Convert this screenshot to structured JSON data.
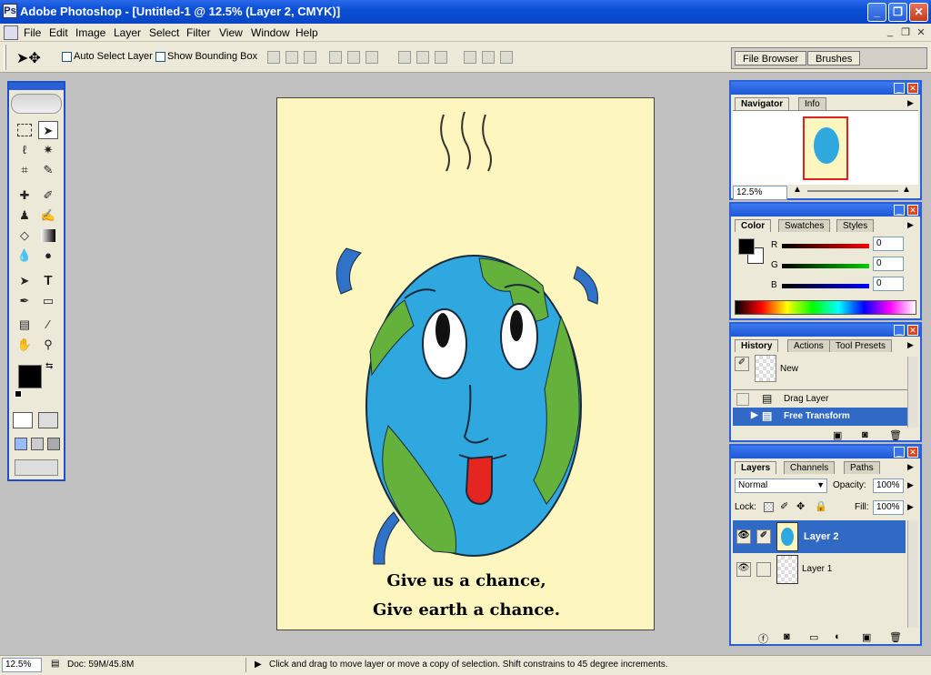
{
  "window": {
    "title": "Adobe Photoshop - [Untitled-1 @ 12.5% (Layer 2, CMYK)]",
    "app_icon": "photoshop-icon",
    "minimize_glyph": "_",
    "maximize_glyph": "❐",
    "close_glyph": "✕"
  },
  "menu": {
    "items": [
      "File",
      "Edit",
      "Image",
      "Layer",
      "Select",
      "Filter",
      "View",
      "Window",
      "Help"
    ],
    "mdi_minimize": "_",
    "mdi_restore": "❐",
    "mdi_close": "✕"
  },
  "options": {
    "auto_select_label": "Auto Select Layer",
    "bounding_box_label": "Show Bounding Box",
    "palette_well_tabs": [
      "File Browser",
      "Brushes"
    ]
  },
  "canvas": {
    "caption_line1": "Give us a chance,",
    "caption_line2": "Give earth a chance.",
    "bg_color": "#fdf6be",
    "ocean_color": "#2fa8e0",
    "land_color": "#64b23c",
    "tongue_color": "#e52620"
  },
  "navigator": {
    "tabs": [
      "Navigator",
      "Info"
    ],
    "zoom": "12.5%"
  },
  "color": {
    "tabs": [
      "Color",
      "Swatches",
      "Styles"
    ],
    "channels": [
      {
        "label": "R",
        "value": "0"
      },
      {
        "label": "G",
        "value": "0"
      },
      {
        "label": "B",
        "value": "0"
      }
    ]
  },
  "history": {
    "tabs": [
      "History",
      "Actions",
      "Tool Presets"
    ],
    "snapshot": "New",
    "items": [
      "Drag Layer",
      "Free Transform"
    ]
  },
  "layers": {
    "tabs": [
      "Layers",
      "Channels",
      "Paths"
    ],
    "blend_mode": "Normal",
    "opacity_label": "Opacity:",
    "opacity": "100%",
    "lock_label": "Lock:",
    "fill_label": "Fill:",
    "fill": "100%",
    "items": [
      "Layer 2",
      "Layer 1"
    ]
  },
  "status": {
    "zoom": "12.5%",
    "doc": "Doc: 59M/45.8M",
    "hint": "Click and drag to move layer or move a copy of selection. Shift constrains to 45 degree increments."
  }
}
